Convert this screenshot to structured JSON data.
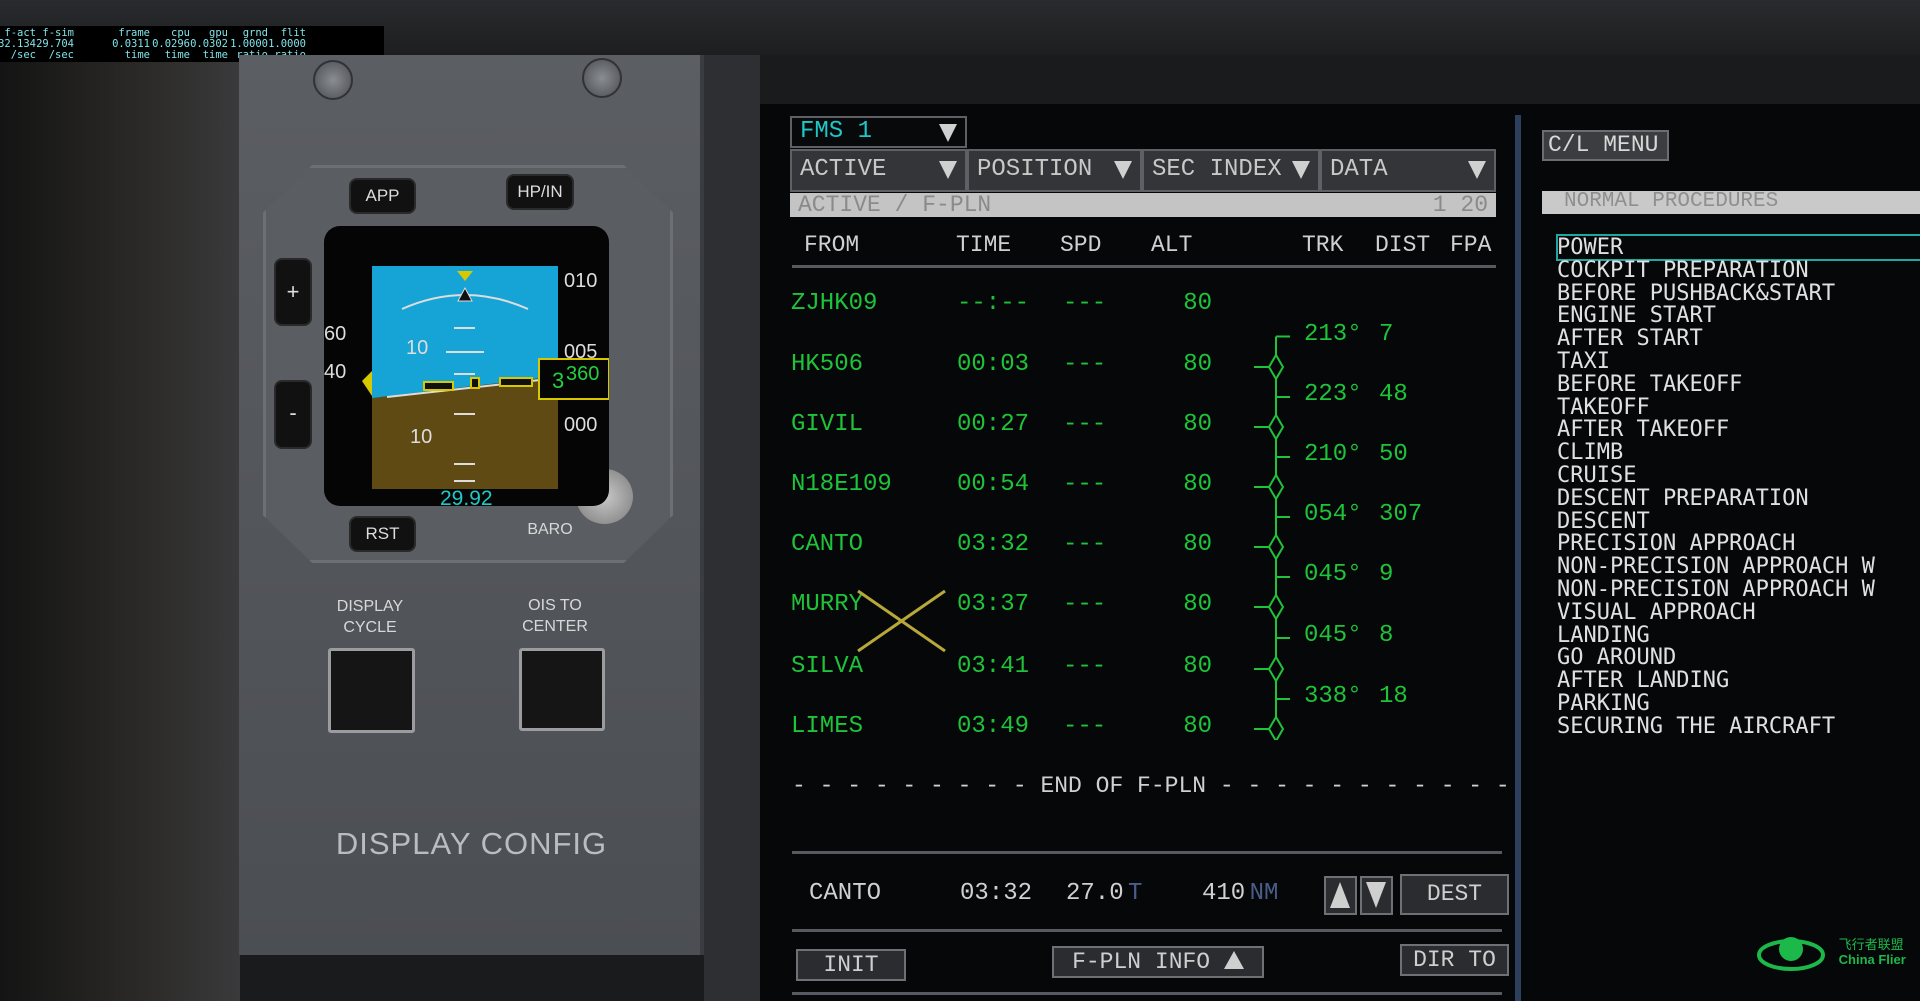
{
  "stats": [
    {
      "label": "f-act",
      "value": "32.134",
      "unit": "/sec"
    },
    {
      "label": "f-sim",
      "value": "29.704",
      "unit": "/sec"
    },
    {
      "label": "frame",
      "value": "0.0311",
      "unit": "time"
    },
    {
      "label": "cpu",
      "value": "0.0296",
      "unit": "time"
    },
    {
      "label": "gpu",
      "value": "0.0302",
      "unit": "time"
    },
    {
      "label": "grnd",
      "value": "1.0000",
      "unit": "ratio"
    },
    {
      "label": "flit",
      "value": "1.0000",
      "unit": "ratio"
    }
  ],
  "standby": {
    "app": "APP",
    "hpin": "HP/IN",
    "rst": "RST",
    "baro": "BARO",
    "plus": "+",
    "minus": "-",
    "speed_ticks": [
      "60",
      "40"
    ],
    "pitch_up": "10",
    "pitch_down": "10",
    "alt_ticks": [
      "010",
      "005",
      "000"
    ],
    "alt_value": "360",
    "alt_prefix": "3",
    "baro_value": "29.92",
    "colors": {
      "sky": "#16a3d6",
      "ground": "#5e4a12",
      "symbol": "#d8c800",
      "alt": "#22d040",
      "baro": "#22c8c8"
    }
  },
  "panel": {
    "display_cycle": "DISPLAY\nCYCLE",
    "ois_to_center": "OIS TO\nCENTER",
    "title": "DISPLAY CONFIG"
  },
  "fms": {
    "selector": "FMS 1",
    "tabs": [
      "ACTIVE",
      "POSITION",
      "SEC INDEX",
      "DATA"
    ],
    "page_title": "ACTIVE / F-PLN",
    "page_num": "1 20",
    "headers": {
      "from": "FROM",
      "time": "TIME",
      "spd": "SPD",
      "alt": "ALT",
      "trk": "TRK",
      "dist": "DIST",
      "fpa": "FPA"
    },
    "waypoints": [
      {
        "name": "ZJHK09",
        "time": "--:--",
        "spd": "---",
        "alt": "80"
      },
      {
        "name": "HK506",
        "time": "00:03",
        "spd": "---",
        "alt": "80"
      },
      {
        "name": "GIVIL",
        "time": "00:27",
        "spd": "---",
        "alt": "80"
      },
      {
        "name": "N18E109",
        "time": "00:54",
        "spd": "---",
        "alt": "80"
      },
      {
        "name": "CANTO",
        "time": "03:32",
        "spd": "---",
        "alt": "80"
      },
      {
        "name": "MURRY",
        "time": "03:37",
        "spd": "---",
        "alt": "80"
      },
      {
        "name": "SILVA",
        "time": "03:41",
        "spd": "---",
        "alt": "80"
      },
      {
        "name": "LIMES",
        "time": "03:49",
        "spd": "---",
        "alt": "80"
      }
    ],
    "legs": [
      {
        "trk": "213°",
        "dist": "7"
      },
      {
        "trk": "223°",
        "dist": "48"
      },
      {
        "trk": "210°",
        "dist": "50"
      },
      {
        "trk": "054°",
        "dist": "307"
      },
      {
        "trk": "045°",
        "dist": "9"
      },
      {
        "trk": "045°",
        "dist": "8"
      },
      {
        "trk": "338°",
        "dist": "18"
      }
    ],
    "end_label": "- - - - - - - - - END OF F-PLN - - - - - - - - - - -",
    "dest": {
      "name": "CANTO",
      "time": "03:32",
      "fuel": "27.0",
      "fuel_unit": "T",
      "dist": "410",
      "dist_unit": "NM"
    },
    "buttons": {
      "dest": "DEST",
      "init": "INIT",
      "fpln_info": "F-PLN INFO",
      "dir_to": "DIR TO"
    },
    "colors": {
      "green": "#1fc33a",
      "white": "#d0d0d0",
      "cyan": "#1fc8c8"
    }
  },
  "checklist": {
    "menu": "C/L MENU",
    "section": "NORMAL PROCEDURES",
    "selected": "POWER",
    "items": [
      "POWER",
      "COCKPIT PREPARATION",
      "BEFORE PUSHBACK&START",
      "ENGINE START",
      "AFTER START",
      "TAXI",
      "BEFORE TAKEOFF",
      "TAKEOFF",
      "AFTER TAKEOFF",
      "CLIMB",
      "CRUISE",
      "DESCENT PREPARATION",
      "DESCENT",
      "PRECISION APPROACH",
      "NON-PRECISION APPROACH W",
      "NON-PRECISION APPROACH W",
      "VISUAL APPROACH",
      "LANDING",
      "GO AROUND",
      "AFTER LANDING",
      "PARKING",
      "SECURING THE AIRCRAFT"
    ]
  },
  "watermark": {
    "cn": "飞行者联盟",
    "en": "China Flier"
  }
}
